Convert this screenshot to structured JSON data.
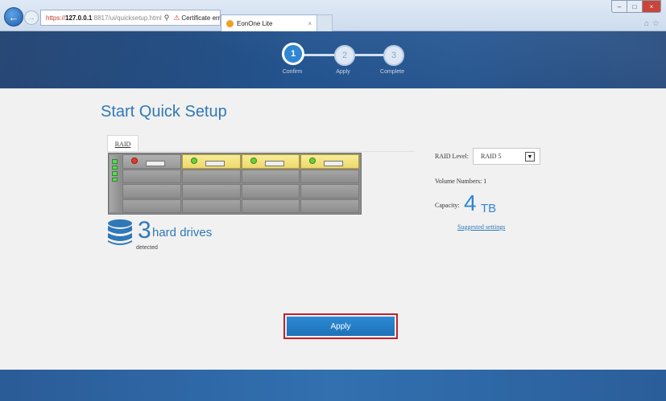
{
  "browser": {
    "address": {
      "scheme": "https://",
      "host": "127.0.0.1",
      "rest": ":8817/ui/quicksetup.html",
      "search_icon": "search-icon",
      "certificate_error": "Certificate error",
      "refresh_icon": "refresh-icon"
    },
    "tab": {
      "label": "EonOne Lite",
      "close": "×"
    },
    "window_controls": {
      "minimize": "–",
      "maximize": "□",
      "close": "×"
    },
    "right_icons": [
      "home-icon",
      "star-icon"
    ]
  },
  "stepper": {
    "steps": [
      {
        "number": "1",
        "label": "Confirm",
        "state": "active"
      },
      {
        "number": "2",
        "label": "Apply",
        "state": "idle"
      },
      {
        "number": "3",
        "label": "Complete",
        "state": "idle"
      }
    ]
  },
  "main": {
    "title": "Start Quick Setup",
    "raid_tab_label": "RAID",
    "drive_bays": {
      "populated": 3,
      "first_bay_status": "error",
      "led_count": 4
    },
    "drives": {
      "count": "3",
      "label": "hard drives",
      "sub": "detected"
    },
    "settings": {
      "raid_level_label": "RAID Level:",
      "raid_level_value": "RAID 5",
      "volume_numbers": "Volume Numbers:  1",
      "capacity_label": "Capacity:",
      "capacity_value": "4",
      "capacity_unit": "TB",
      "suggested_link": "Suggested settings"
    },
    "apply_label": "Apply"
  },
  "colors": {
    "accent": "#2f78b8",
    "banner": "#24548e",
    "highlight_border": "#c0202a"
  }
}
